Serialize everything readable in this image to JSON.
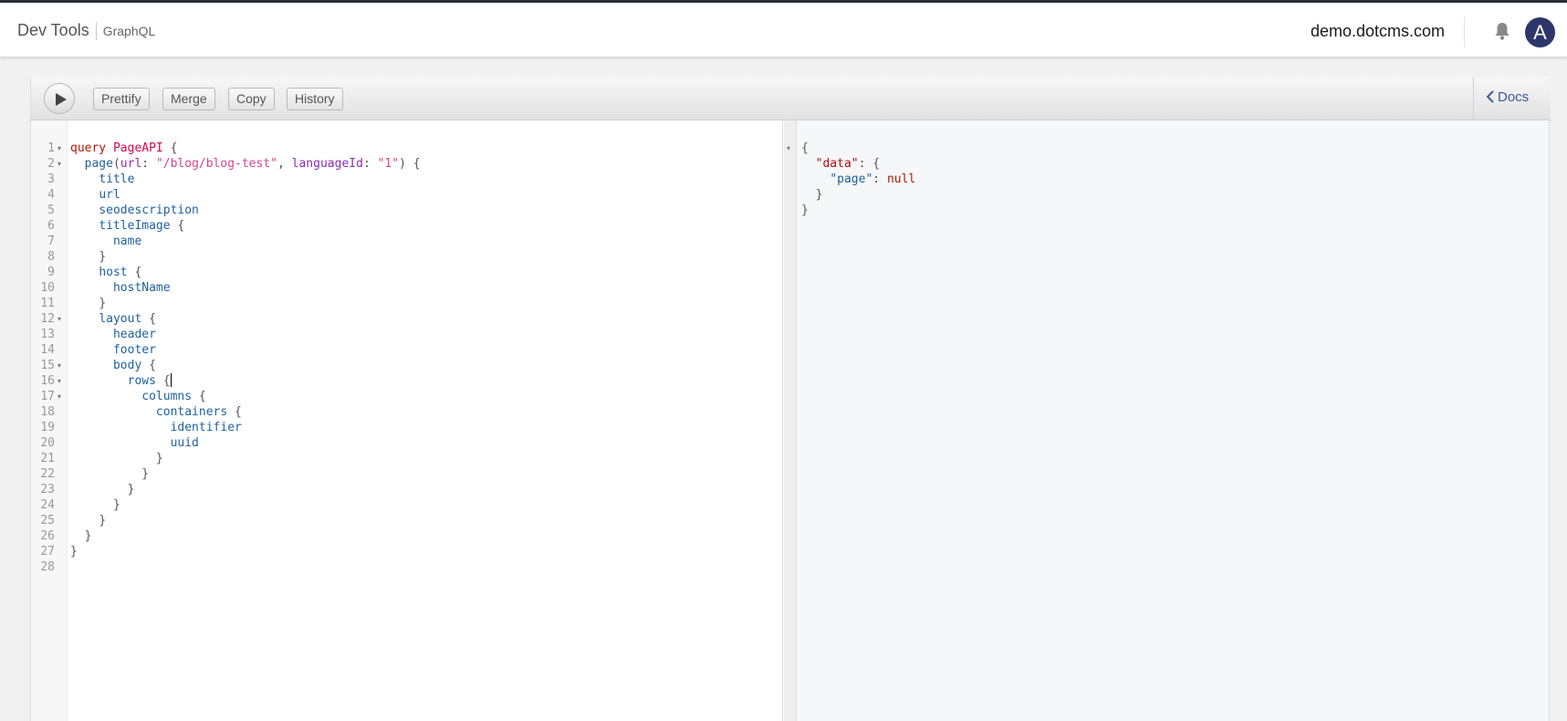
{
  "header": {
    "title": "Dev Tools",
    "subtitle": "GraphQL",
    "site": "demo.dotcms.com",
    "avatar_initial": "A",
    "bell_icon": "bell-icon"
  },
  "toolbar": {
    "run_icon": "play-icon",
    "prettify_label": "Prettify",
    "merge_label": "Merge",
    "copy_label": "Copy",
    "history_label": "History",
    "docs_label": "Docs"
  },
  "editor": {
    "line_numbers": [
      "1",
      "2",
      "3",
      "4",
      "5",
      "6",
      "7",
      "8",
      "9",
      "10",
      "11",
      "12",
      "13",
      "14",
      "15",
      "16",
      "17",
      "18",
      "19",
      "20",
      "21",
      "22",
      "23",
      "24",
      "25",
      "26",
      "27",
      "28"
    ],
    "lines": [
      [
        {
          "t": "query",
          "c": "kw"
        },
        {
          "t": " "
        },
        {
          "t": "PageAPI",
          "c": "def"
        },
        {
          "t": " {",
          "c": "punc"
        }
      ],
      [
        {
          "t": "  "
        },
        {
          "t": "page",
          "c": "prop"
        },
        {
          "t": "(",
          "c": "punc"
        },
        {
          "t": "url",
          "c": "attr"
        },
        {
          "t": ": ",
          "c": "punc"
        },
        {
          "t": "\"/blog/blog-test\"",
          "c": "str"
        },
        {
          "t": ", ",
          "c": "punc"
        },
        {
          "t": "languageId",
          "c": "attr"
        },
        {
          "t": ": ",
          "c": "punc"
        },
        {
          "t": "\"1\"",
          "c": "str"
        },
        {
          "t": ") {",
          "c": "punc"
        }
      ],
      [
        {
          "t": "    "
        },
        {
          "t": "title",
          "c": "prop"
        }
      ],
      [
        {
          "t": "    "
        },
        {
          "t": "url",
          "c": "prop"
        }
      ],
      [
        {
          "t": "    "
        },
        {
          "t": "seodescription",
          "c": "prop"
        }
      ],
      [
        {
          "t": "    "
        },
        {
          "t": "titleImage",
          "c": "prop"
        },
        {
          "t": " {",
          "c": "punc"
        }
      ],
      [
        {
          "t": "      "
        },
        {
          "t": "name",
          "c": "prop"
        }
      ],
      [
        {
          "t": "    "
        },
        {
          "t": "}",
          "c": "punc"
        }
      ],
      [
        {
          "t": "    "
        },
        {
          "t": "host",
          "c": "prop"
        },
        {
          "t": " {",
          "c": "punc"
        }
      ],
      [
        {
          "t": "      "
        },
        {
          "t": "hostName",
          "c": "prop"
        }
      ],
      [
        {
          "t": "    "
        },
        {
          "t": "}",
          "c": "punc"
        }
      ],
      [
        {
          "t": "    "
        },
        {
          "t": "layout",
          "c": "prop"
        },
        {
          "t": " {",
          "c": "punc"
        }
      ],
      [
        {
          "t": "      "
        },
        {
          "t": "header",
          "c": "prop"
        }
      ],
      [
        {
          "t": "      "
        },
        {
          "t": "footer",
          "c": "prop"
        }
      ],
      [
        {
          "t": "      "
        },
        {
          "t": "body",
          "c": "prop"
        },
        {
          "t": " {",
          "c": "punc"
        }
      ],
      [
        {
          "t": "        "
        },
        {
          "t": "rows",
          "c": "prop"
        },
        {
          "t": " {",
          "c": "punc"
        }
      ],
      [
        {
          "t": "          "
        },
        {
          "t": "columns",
          "c": "prop"
        },
        {
          "t": " {",
          "c": "punc"
        }
      ],
      [
        {
          "t": "            "
        },
        {
          "t": "containers",
          "c": "prop"
        },
        {
          "t": " {",
          "c": "punc"
        }
      ],
      [
        {
          "t": "              "
        },
        {
          "t": "identifier",
          "c": "prop"
        }
      ],
      [
        {
          "t": "              "
        },
        {
          "t": "uuid",
          "c": "prop"
        }
      ],
      [
        {
          "t": "            "
        },
        {
          "t": "}",
          "c": "punc"
        }
      ],
      [
        {
          "t": "          "
        },
        {
          "t": "}",
          "c": "punc"
        }
      ],
      [
        {
          "t": "        "
        },
        {
          "t": "}",
          "c": "punc"
        }
      ],
      [
        {
          "t": "      "
        },
        {
          "t": "}",
          "c": "punc"
        }
      ],
      [
        {
          "t": "    "
        },
        {
          "t": "}",
          "c": "punc"
        }
      ],
      [
        {
          "t": "  "
        },
        {
          "t": "}",
          "c": "punc"
        }
      ],
      [
        {
          "t": "}",
          "c": "punc"
        }
      ],
      []
    ],
    "fold_lines": [
      1,
      2,
      12,
      15,
      16,
      17
    ],
    "cursor_line": 16
  },
  "result": {
    "lines": [
      [
        {
          "t": "{",
          "c": "punc"
        }
      ],
      [
        {
          "t": "  "
        },
        {
          "t": "\"data\"",
          "c": "jkey"
        },
        {
          "t": ": {",
          "c": "punc"
        }
      ],
      [
        {
          "t": "    "
        },
        {
          "t": "\"page\"",
          "c": "prop"
        },
        {
          "t": ": ",
          "c": "punc"
        },
        {
          "t": "null",
          "c": "null"
        }
      ],
      [
        {
          "t": "  "
        },
        {
          "t": "}",
          "c": "punc"
        }
      ],
      [
        {
          "t": "}",
          "c": "punc"
        }
      ]
    ],
    "fold_lines": [
      1
    ]
  }
}
